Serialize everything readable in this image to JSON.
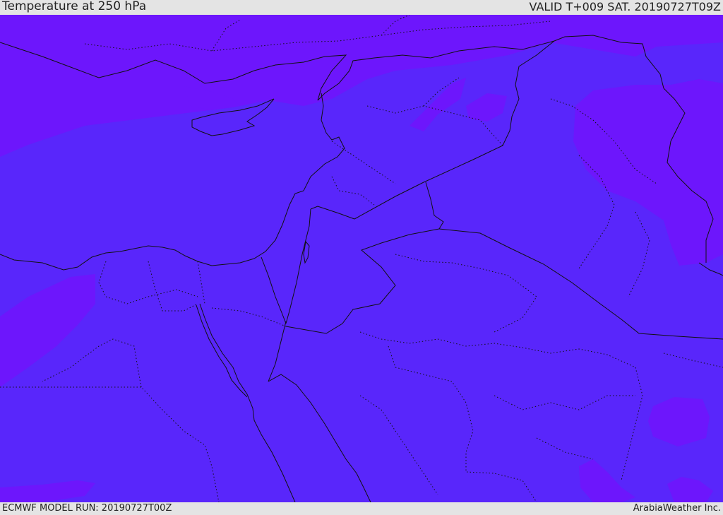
{
  "header": {
    "title": "Temperature at 250 hPa",
    "valid_time": "VALID T+009 SAT. 20190727T09Z"
  },
  "footer": {
    "model_run": "ECMWF MODEL RUN: 20190727T00Z",
    "provider": "ArabiaWeather Inc."
  },
  "colors": {
    "base_field": "#5926fb",
    "cold_field": "#6d16fc",
    "coastline": "#111111",
    "bar_background": "#e4e4e4"
  },
  "map": {
    "field": "temperature-250hPa",
    "style": "filled-contours",
    "overlays": [
      "coastlines",
      "national-borders",
      "admin-boundaries-dotted"
    ]
  }
}
